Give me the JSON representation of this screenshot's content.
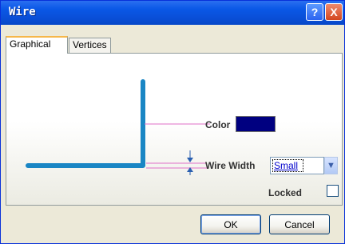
{
  "window": {
    "title": "Wire"
  },
  "titlebar": {
    "help_symbol": "?",
    "close_symbol": "X"
  },
  "tabs": [
    {
      "label": "Graphical"
    },
    {
      "label": "Vertices"
    }
  ],
  "graphical": {
    "color_label": "Color",
    "color_value": "#000080",
    "wire_width_label": "Wire Width",
    "wire_width_selected": "Small",
    "locked_label": "Locked",
    "locked_checked": false,
    "wire_color": "#1a86c4"
  },
  "buttons": {
    "ok": "OK",
    "cancel": "Cancel"
  }
}
